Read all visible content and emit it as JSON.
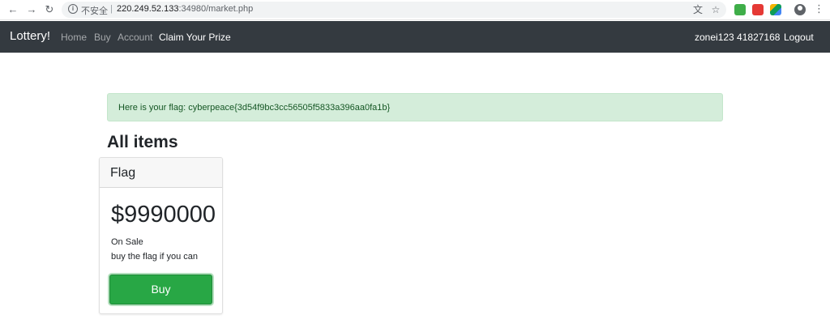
{
  "browser": {
    "security_label": "不安全",
    "separator": "|",
    "url_host": "220.249.52.133",
    "url_path": ":34980/market.php"
  },
  "navbar": {
    "brand": "Lottery!",
    "links": [
      "Home",
      "Buy",
      "Account",
      "Claim Your Prize"
    ],
    "user": "zonei123 41827168",
    "logout": "Logout"
  },
  "alert": {
    "message": "Here is your flag: cyberpeace{3d54f9bc3cc56505f5833a396aa0fa1b}"
  },
  "page": {
    "heading": "All items"
  },
  "item": {
    "name": "Flag",
    "price": "$9990000",
    "status": "On Sale",
    "description": "buy the flag if you can",
    "button": "Buy"
  },
  "colors": {
    "navbar_bg": "#343a40",
    "alert_bg": "#d4edda",
    "button_green": "#28a745"
  }
}
